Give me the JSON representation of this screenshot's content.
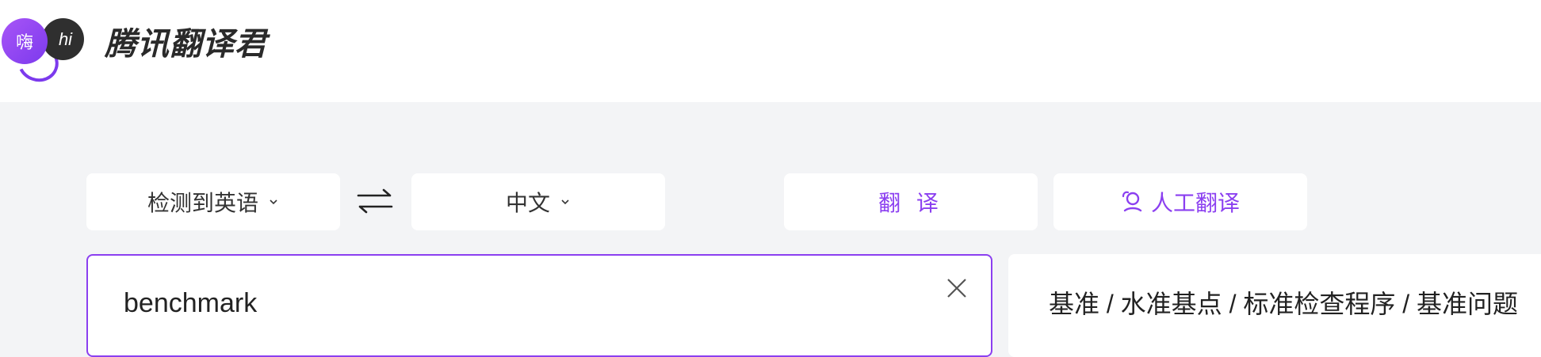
{
  "header": {
    "logo": {
      "bubble_left": "嗨",
      "bubble_right": "hi",
      "accent": "#7c3aed"
    },
    "brand": "腾讯翻译君"
  },
  "toolbar": {
    "source_lang": "检测到英语",
    "target_lang": "中文",
    "swap_icon": "swap-arrows-icon",
    "translate_label": "翻 译",
    "human_translate_label": "人工翻译"
  },
  "input": {
    "value": "benchmark"
  },
  "output": {
    "text": "基准 / 水准基点 / 标准检查程序 / 基准问题"
  },
  "colors": {
    "accent": "#8b3ff0",
    "background": "#f3f4f6",
    "card": "#ffffff"
  }
}
